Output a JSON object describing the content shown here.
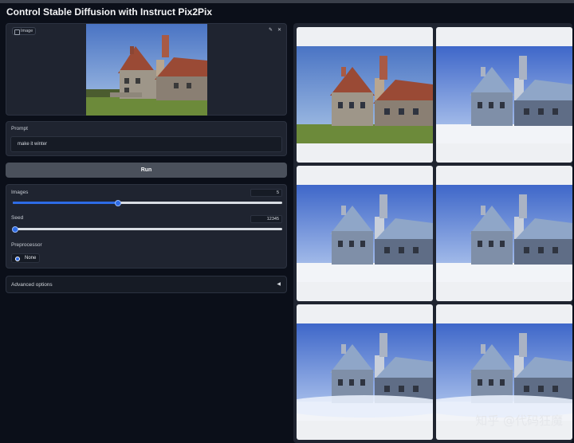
{
  "app": {
    "title": "Control Stable Diffusion with Instruct Pix2Pix"
  },
  "image_input": {
    "label": "Image",
    "edit_icon": "pencil-icon",
    "clear_icon": "close-icon"
  },
  "prompt": {
    "label": "Prompt",
    "value": "make it winter"
  },
  "run_button": {
    "label": "Run"
  },
  "images_slider": {
    "label": "Images",
    "value": "5",
    "fraction": 0.39
  },
  "seed_slider": {
    "label": "Seed",
    "value": "12345",
    "fraction": 0.0
  },
  "preprocessor": {
    "label": "Preprocessor",
    "options": [
      "None"
    ],
    "selected": "None"
  },
  "advanced": {
    "label": "Advanced options",
    "icon": "triangle-left-icon"
  },
  "gallery": {
    "items": [
      {
        "scene": "original"
      },
      {
        "scene": "winter"
      },
      {
        "scene": "winter"
      },
      {
        "scene": "winter"
      },
      {
        "scene": "winter-fog"
      },
      {
        "scene": "winter-fog"
      }
    ]
  },
  "watermark": "知乎 @代码狂魔",
  "colors": {
    "background": "#0b0f19",
    "panel": "#1f2430",
    "accent": "#2d6be6"
  }
}
